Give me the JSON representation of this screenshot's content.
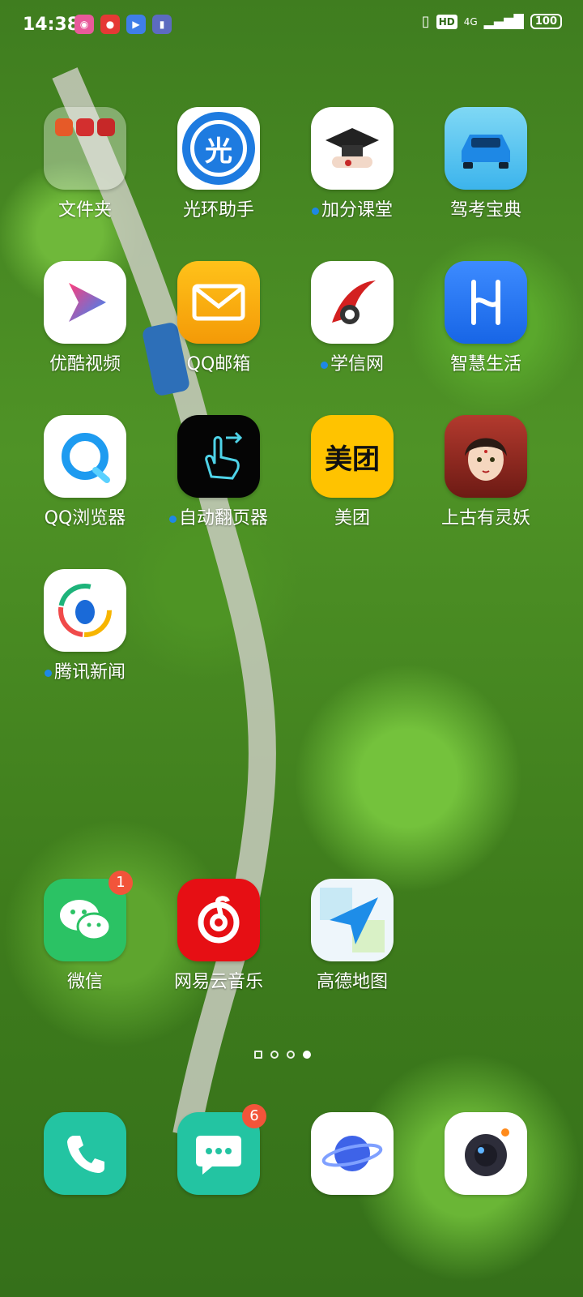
{
  "status_bar": {
    "time": "14:38",
    "hd": "HD",
    "network": "4G",
    "battery": "100"
  },
  "apps": [
    {
      "label": "文件夹",
      "icon": "folder-icon",
      "dot": false
    },
    {
      "label": "光环助手",
      "icon": "guanghuan-icon",
      "dot": false
    },
    {
      "label": "加分课堂",
      "icon": "graduation-cap-icon",
      "dot": true
    },
    {
      "label": "驾考宝典",
      "icon": "car-icon",
      "dot": false
    },
    {
      "label": "优酷视频",
      "icon": "youku-play-icon",
      "dot": false
    },
    {
      "label": "QQ邮箱",
      "icon": "mail-icon",
      "dot": false
    },
    {
      "label": "学信网",
      "icon": "xuexin-icon",
      "dot": true
    },
    {
      "label": "智慧生活",
      "icon": "smart-life-icon",
      "dot": false
    },
    {
      "label": "QQ浏览器",
      "icon": "qq-browser-icon",
      "dot": false
    },
    {
      "label": "自动翻页器",
      "icon": "swipe-hand-icon",
      "dot": true
    },
    {
      "label": "美团",
      "icon": "meituan-icon",
      "dot": false
    },
    {
      "label": "上古有灵妖",
      "icon": "game-character-icon",
      "dot": false
    },
    {
      "label": "腾讯新闻",
      "icon": "tencent-news-icon",
      "dot": true
    },
    {
      "label": "微信",
      "icon": "wechat-icon",
      "badge": "1"
    },
    {
      "label": "网易云音乐",
      "icon": "netease-music-icon"
    },
    {
      "label": "高德地图",
      "icon": "amap-icon"
    }
  ],
  "meituan_text": "美团",
  "guanghuan_text": "光",
  "dock": [
    {
      "icon": "phone-icon"
    },
    {
      "icon": "messages-icon",
      "badge": "6"
    },
    {
      "icon": "browser-planet-icon"
    },
    {
      "icon": "camera-icon"
    }
  ]
}
